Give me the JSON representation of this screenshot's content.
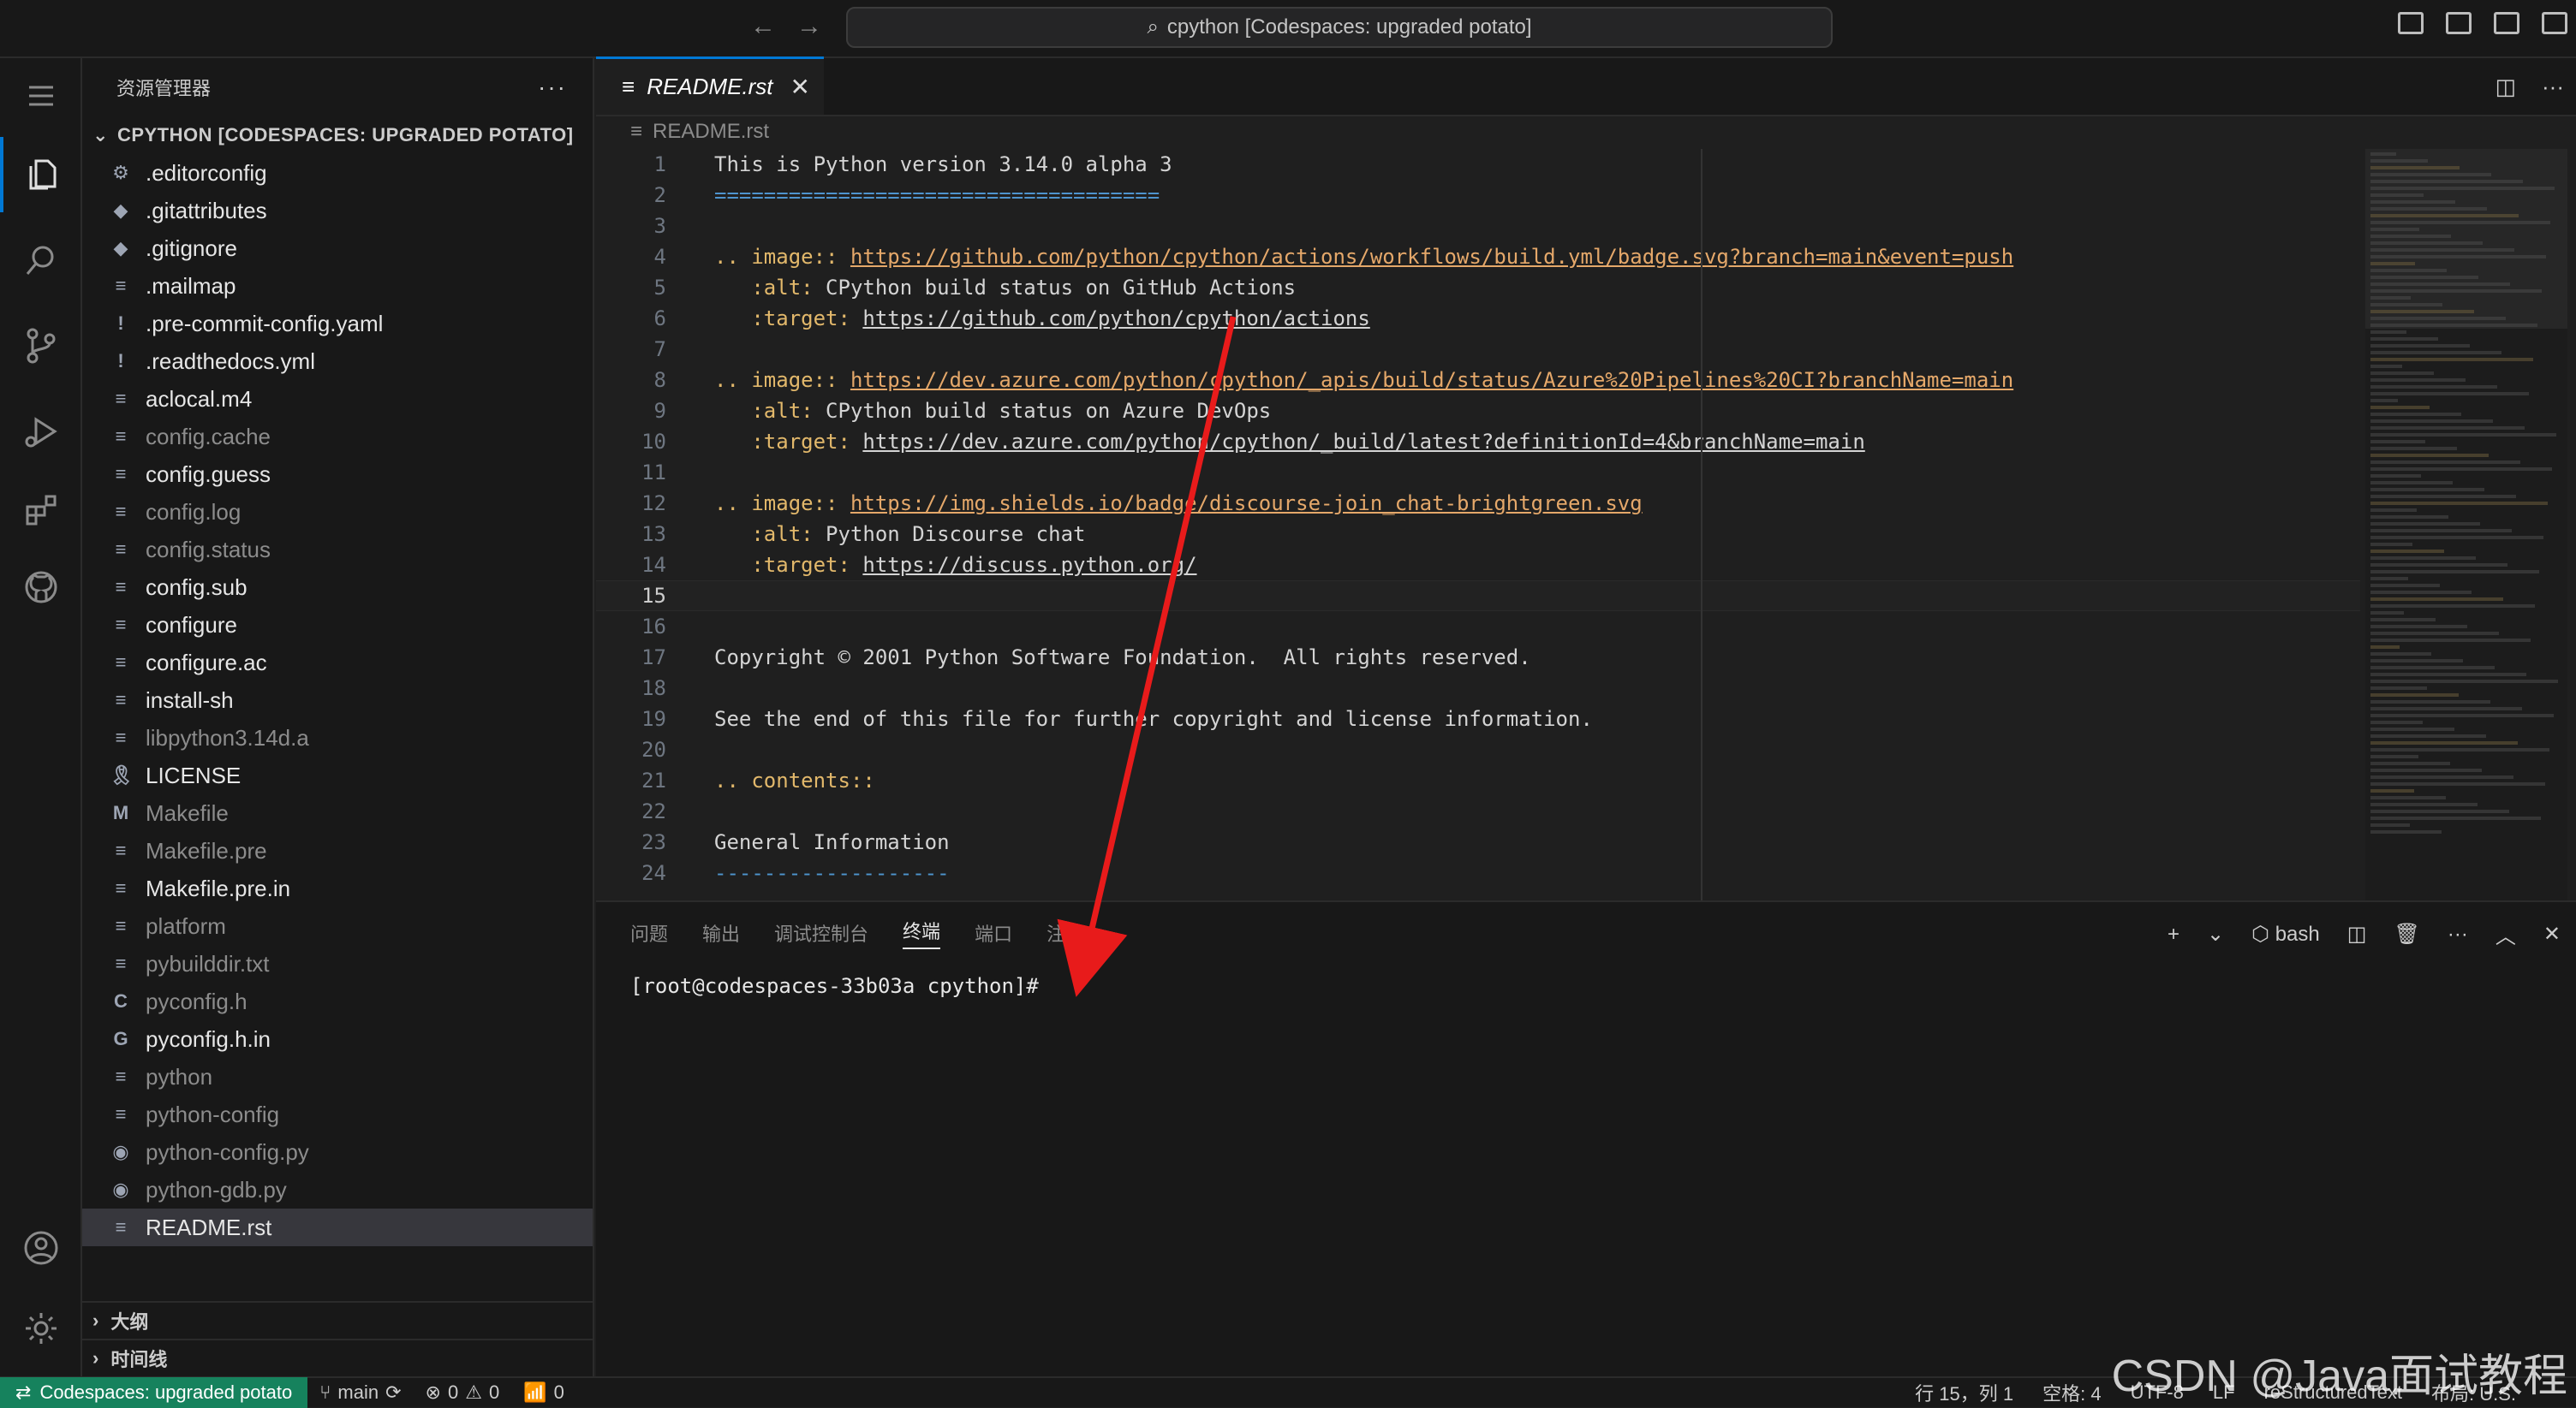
{
  "titlebar": {
    "command_center": "cpython [Codespaces: upgraded potato]",
    "back": "←",
    "forward": "→"
  },
  "sidebar": {
    "title": "资源管理器",
    "more": "···",
    "section": "CPYTHON [CODESPACES: UPGRADED POTATO]",
    "files": [
      {
        "name": ".editorconfig",
        "icon": "⚙",
        "dim": false
      },
      {
        "name": ".gitattributes",
        "icon": "◆",
        "dim": false
      },
      {
        "name": ".gitignore",
        "icon": "◆",
        "dim": false
      },
      {
        "name": ".mailmap",
        "icon": "≡",
        "dim": false
      },
      {
        "name": ".pre-commit-config.yaml",
        "icon": "!",
        "dim": false
      },
      {
        "name": ".readthedocs.yml",
        "icon": "!",
        "dim": false
      },
      {
        "name": "aclocal.m4",
        "icon": "≡",
        "dim": false
      },
      {
        "name": "config.cache",
        "icon": "≡",
        "dim": true
      },
      {
        "name": "config.guess",
        "icon": "≡",
        "dim": false
      },
      {
        "name": "config.log",
        "icon": "≡",
        "dim": true
      },
      {
        "name": "config.status",
        "icon": "≡",
        "dim": true
      },
      {
        "name": "config.sub",
        "icon": "≡",
        "dim": false
      },
      {
        "name": "configure",
        "icon": "≡",
        "dim": false
      },
      {
        "name": "configure.ac",
        "icon": "≡",
        "dim": false
      },
      {
        "name": "install-sh",
        "icon": "≡",
        "dim": false
      },
      {
        "name": "libpython3.14d.a",
        "icon": "≡",
        "dim": true
      },
      {
        "name": "LICENSE",
        "icon": "🎗",
        "dim": false
      },
      {
        "name": "Makefile",
        "icon": "M",
        "dim": true
      },
      {
        "name": "Makefile.pre",
        "icon": "≡",
        "dim": true
      },
      {
        "name": "Makefile.pre.in",
        "icon": "≡",
        "dim": false
      },
      {
        "name": "platform",
        "icon": "≡",
        "dim": true
      },
      {
        "name": "pybuilddir.txt",
        "icon": "≡",
        "dim": true
      },
      {
        "name": "pyconfig.h",
        "icon": "C",
        "dim": true
      },
      {
        "name": "pyconfig.h.in",
        "icon": "G",
        "dim": false
      },
      {
        "name": "python",
        "icon": "≡",
        "dim": true
      },
      {
        "name": "python-config",
        "icon": "≡",
        "dim": true
      },
      {
        "name": "python-config.py",
        "icon": "◉",
        "dim": true
      },
      {
        "name": "python-gdb.py",
        "icon": "◉",
        "dim": true
      },
      {
        "name": "README.rst",
        "icon": "≡",
        "dim": false,
        "selected": true
      }
    ],
    "outline": "大纲",
    "timeline": "时间线"
  },
  "editor": {
    "tab_name": "README.rst",
    "close": "✕",
    "breadcrumb": "README.rst",
    "lines": [
      {
        "n": "1",
        "segs": [
          {
            "t": "This is Python version 3.14.0 alpha 3",
            "c": ""
          }
        ]
      },
      {
        "n": "2",
        "segs": [
          {
            "t": "====================================",
            "c": "heading"
          }
        ]
      },
      {
        "n": "3",
        "segs": []
      },
      {
        "n": "4",
        "segs": [
          {
            "t": ".. image:: ",
            "c": "dir"
          },
          {
            "t": "https://github.com/python/cpython/actions/workflows/build.yml/badge.svg?branch=main&event=push",
            "c": "url"
          }
        ]
      },
      {
        "n": "5",
        "segs": [
          {
            "t": "   :alt: ",
            "c": "dir"
          },
          {
            "t": "CPython build status on GitHub Actions",
            "c": ""
          }
        ]
      },
      {
        "n": "6",
        "segs": [
          {
            "t": "   :target: ",
            "c": "dir"
          },
          {
            "t": "https://github.com/python/cpython/actions",
            "c": "link"
          }
        ]
      },
      {
        "n": "7",
        "segs": []
      },
      {
        "n": "8",
        "segs": [
          {
            "t": ".. image:: ",
            "c": "dir"
          },
          {
            "t": "https://dev.azure.com/python/cpython/_apis/build/status/Azure%20Pipelines%20CI?branchName=main",
            "c": "url"
          }
        ]
      },
      {
        "n": "9",
        "segs": [
          {
            "t": "   :alt: ",
            "c": "dir"
          },
          {
            "t": "CPython build status on Azure DevOps",
            "c": ""
          }
        ]
      },
      {
        "n": "10",
        "segs": [
          {
            "t": "   :target: ",
            "c": "dir"
          },
          {
            "t": "https://dev.azure.com/python/cpython/_build/latest?definitionId=4&branchName=main",
            "c": "link"
          }
        ]
      },
      {
        "n": "11",
        "segs": []
      },
      {
        "n": "12",
        "segs": [
          {
            "t": ".. image:: ",
            "c": "dir"
          },
          {
            "t": "https://img.shields.io/badge/discourse-join_chat-brightgreen.svg",
            "c": "url"
          }
        ]
      },
      {
        "n": "13",
        "segs": [
          {
            "t": "   :alt: ",
            "c": "dir"
          },
          {
            "t": "Python Discourse chat",
            "c": ""
          }
        ]
      },
      {
        "n": "14",
        "segs": [
          {
            "t": "   :target: ",
            "c": "dir"
          },
          {
            "t": "https://discuss.python.org/",
            "c": "link"
          }
        ]
      },
      {
        "n": "15",
        "segs": [],
        "current": true
      },
      {
        "n": "16",
        "segs": []
      },
      {
        "n": "17",
        "segs": [
          {
            "t": "Copyright © 2001 Python Software Foundation.  All rights reserved.",
            "c": ""
          }
        ]
      },
      {
        "n": "18",
        "segs": []
      },
      {
        "n": "19",
        "segs": [
          {
            "t": "See the end of this file for further copyright and license information.",
            "c": ""
          }
        ]
      },
      {
        "n": "20",
        "segs": []
      },
      {
        "n": "21",
        "segs": [
          {
            "t": ".. contents::",
            "c": "dir"
          }
        ]
      },
      {
        "n": "22",
        "segs": []
      },
      {
        "n": "23",
        "segs": [
          {
            "t": "General Information",
            "c": ""
          }
        ]
      },
      {
        "n": "24",
        "segs": [
          {
            "t": "-------------------",
            "c": "heading"
          }
        ]
      }
    ]
  },
  "panel": {
    "tabs": [
      "问题",
      "输出",
      "调试控制台",
      "终端",
      "端口",
      "注释"
    ],
    "active_tab": "终端",
    "shell": "bash",
    "add": "+",
    "prompt": "[root@codespaces-33b03a cpython]#"
  },
  "statusbar": {
    "remote": "Codespaces: upgraded potato",
    "branch": "main",
    "errors": "0",
    "warnings": "0",
    "ports": "0",
    "position": "行 15，列 1",
    "spaces": "空格: 4",
    "encoding": "UTF-8",
    "eol": "LF",
    "language": "reStructuredText",
    "layout": "布局: U.S."
  },
  "watermark": "CSDN @Java面试教程",
  "colors": {
    "accent": "#0078d4",
    "remote": "#16825d",
    "arrow": "#e81b1b"
  }
}
